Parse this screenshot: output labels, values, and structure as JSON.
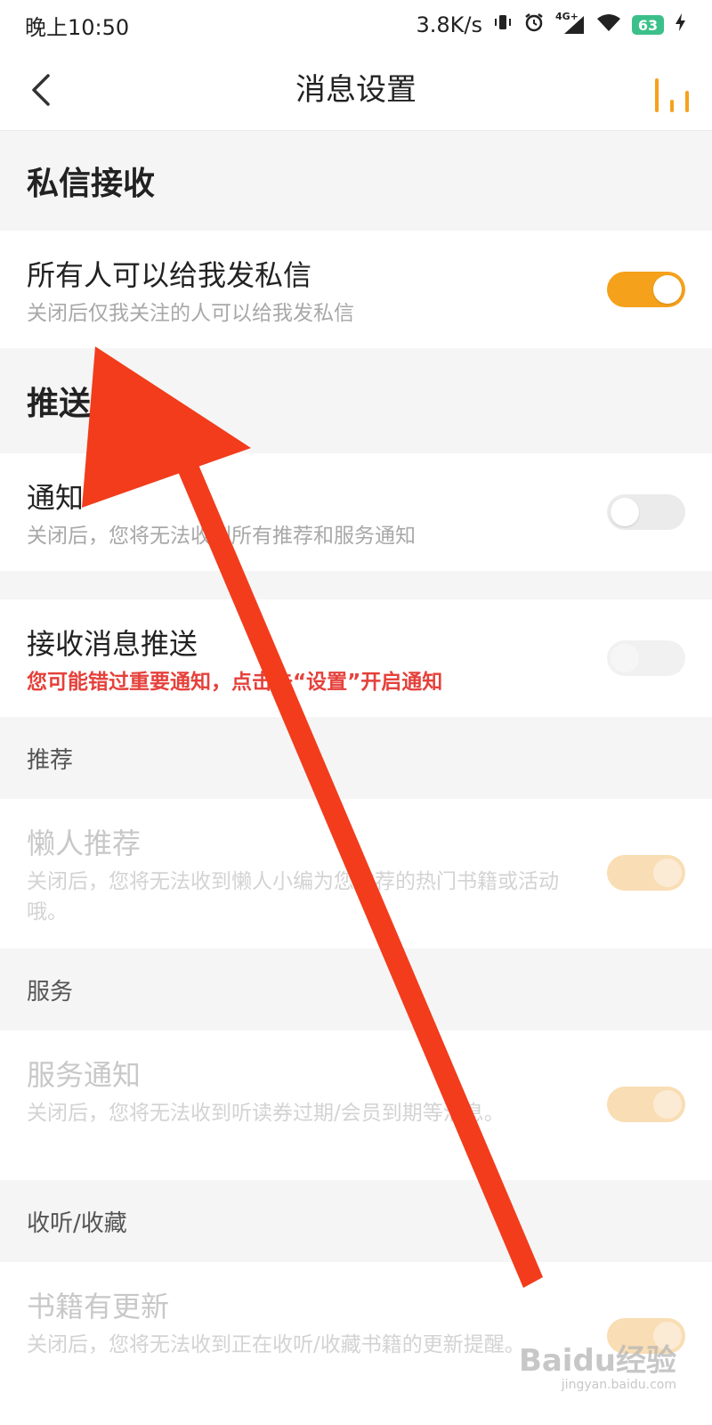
{
  "statusbar": {
    "time": "晚上10:50",
    "net_speed": "3.8K/s",
    "network": "4G+",
    "battery": "63"
  },
  "nav": {
    "title": "消息设置"
  },
  "sections": {
    "private_msg": "私信接收",
    "push": "推送",
    "recommend": "推荐",
    "service": "服务",
    "listen": "收听/收藏"
  },
  "rows": {
    "allow_all": {
      "title": "所有人可以给我发私信",
      "sub": "关闭后仅我关注的人可以给我发私信",
      "on": true
    },
    "notification": {
      "title": "通知",
      "sub": "关闭后，您将无法收到所有推荐和服务通知",
      "on": false
    },
    "receive_push": {
      "title": "接收消息推送",
      "sub": "您可能错过重要通知，点击去“设置”开启通知",
      "on": false
    },
    "lazy_recommend": {
      "title": "懒人推荐",
      "sub": "关闭后，您将无法收到懒人小编为您推荐的热门书籍或活动哦。",
      "on": true
    },
    "service_notice": {
      "title": "服务通知",
      "sub": "关闭后，您将无法收到听读券过期/会员到期等消息。",
      "on": true
    },
    "book_update": {
      "title": "书籍有更新",
      "sub": "关闭后，您将无法收到正在收听/收藏书籍的更新提醒。",
      "on": true
    }
  },
  "watermark": {
    "brand": "Baidu经验",
    "url": "jingyan.baidu.com"
  },
  "colors": {
    "accent": "#f5a11c",
    "warning": "#e5413b",
    "arrow": "#f23c1c"
  }
}
